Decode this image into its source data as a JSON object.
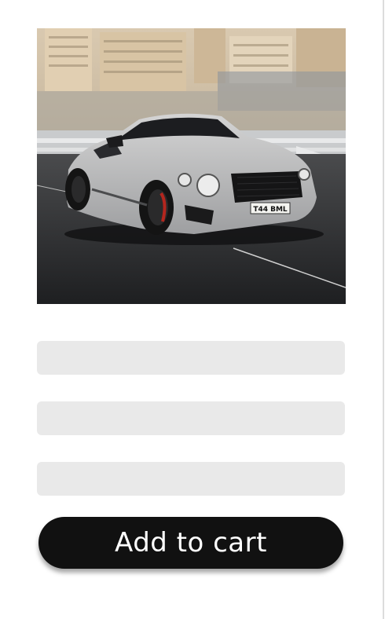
{
  "product": {
    "image_subject": "silver grand touring coupe driving on coastal road",
    "license_plate": "T44 BML"
  },
  "form": {
    "fields": [
      {
        "value": "",
        "placeholder": ""
      },
      {
        "value": "",
        "placeholder": ""
      },
      {
        "value": "",
        "placeholder": ""
      }
    ]
  },
  "actions": {
    "add_to_cart_label": "Add to cart"
  },
  "colors": {
    "button_bg": "#111111",
    "button_text": "#ffffff",
    "field_bg": "#e9e9e9"
  }
}
